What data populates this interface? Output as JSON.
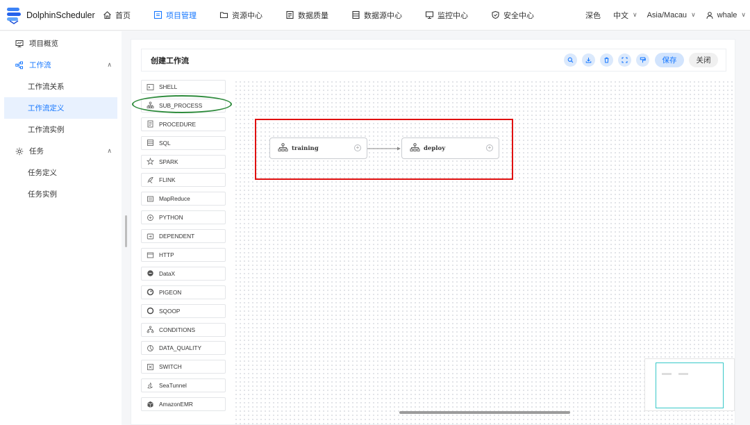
{
  "app": {
    "name": "DolphinScheduler"
  },
  "nav": [
    {
      "label": "首页",
      "icon": "home-icon",
      "active": false
    },
    {
      "label": "项目管理",
      "icon": "project-icon",
      "active": true
    },
    {
      "label": "资源中心",
      "icon": "folder-icon",
      "active": false
    },
    {
      "label": "数据质量",
      "icon": "data-quality-icon",
      "active": false
    },
    {
      "label": "数据源中心",
      "icon": "datasource-icon",
      "active": false
    },
    {
      "label": "监控中心",
      "icon": "monitor-icon",
      "active": false
    },
    {
      "label": "安全中心",
      "icon": "shield-icon",
      "active": false
    }
  ],
  "topright": {
    "theme": "深色",
    "language": "中文",
    "timezone": "Asia/Macau",
    "user": "whale"
  },
  "sidebar": {
    "items": [
      {
        "label": "项目概览",
        "level": "top",
        "icon": "overview-icon"
      },
      {
        "label": "工作流",
        "level": "top",
        "icon": "workflow-icon",
        "expanded": true
      },
      {
        "label": "工作流关系",
        "level": "sub"
      },
      {
        "label": "工作流定义",
        "level": "sub",
        "selected": true
      },
      {
        "label": "工作流实例",
        "level": "sub"
      },
      {
        "label": "任务",
        "level": "top",
        "icon": "task-gear-icon",
        "expanded": true
      },
      {
        "label": "任务定义",
        "level": "sub"
      },
      {
        "label": "任务实例",
        "level": "sub"
      }
    ]
  },
  "editor": {
    "title": "创建工作流",
    "toolbar": {
      "icons": [
        "search-icon",
        "download-icon",
        "delete-icon",
        "fullscreen-icon",
        "format-icon"
      ],
      "save_label": "保存",
      "close_label": "关闭"
    },
    "tasks": [
      "SHELL",
      "SUB_PROCESS",
      "PROCEDURE",
      "SQL",
      "SPARK",
      "FLINK",
      "MapReduce",
      "PYTHON",
      "DEPENDENT",
      "HTTP",
      "DataX",
      "PIGEON",
      "SQOOP",
      "CONDITIONS",
      "DATA_QUALITY",
      "SWITCH",
      "SeaTunnel",
      "AmazonEMR"
    ],
    "nodes": [
      {
        "label": "training",
        "type": "SUB_PROCESS"
      },
      {
        "label": "deploy",
        "type": "SUB_PROCESS"
      }
    ],
    "edges": [
      {
        "from": "training",
        "to": "deploy"
      }
    ]
  },
  "colors": {
    "accent": "#1677ff",
    "highlight_box": "#e01010",
    "highlight_ellipse": "#2e8b3c",
    "minimap_view": "#36c8c8"
  }
}
